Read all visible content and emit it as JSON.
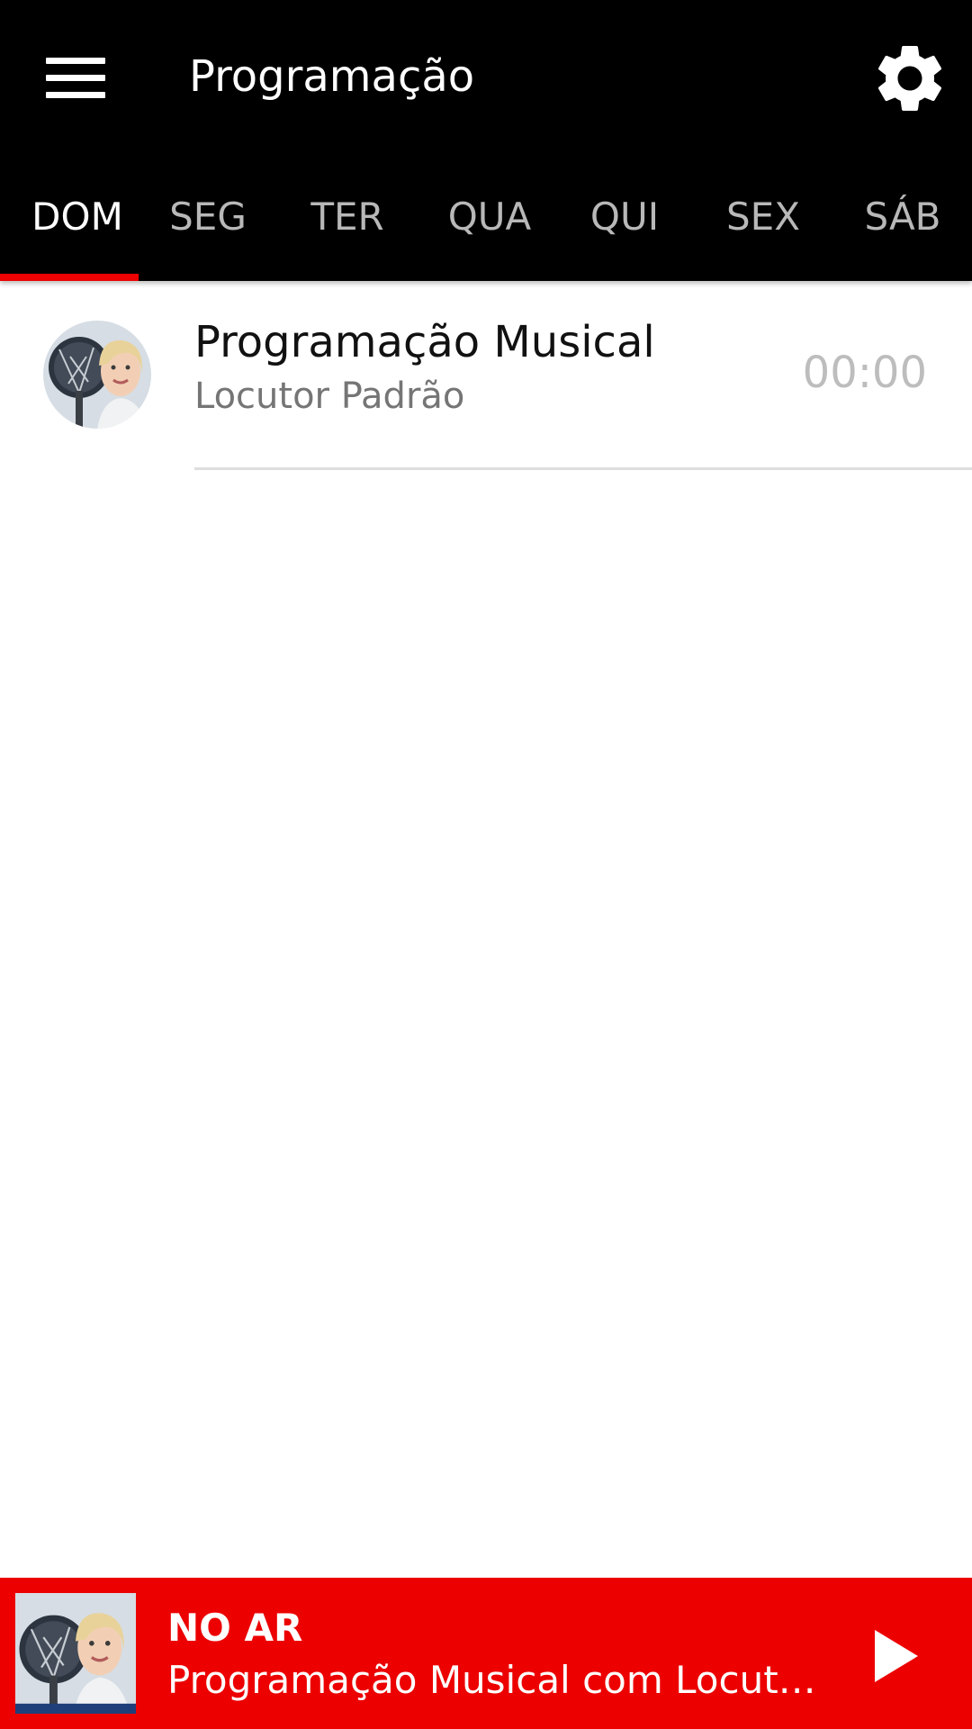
{
  "header": {
    "title": "Programação",
    "menu_icon": "hamburger-menu-icon",
    "settings_icon": "gear-icon"
  },
  "tabs": [
    {
      "label": "DOM",
      "active": true
    },
    {
      "label": "SEG",
      "active": false
    },
    {
      "label": "TER",
      "active": false
    },
    {
      "label": "QUA",
      "active": false
    },
    {
      "label": "QUI",
      "active": false
    },
    {
      "label": "SEX",
      "active": false
    },
    {
      "label": "SÁB",
      "active": false
    }
  ],
  "schedule": [
    {
      "title": "Programação Musical",
      "host": "Locutor Padrão",
      "time": "00:00",
      "avatar_icon": "host-avatar"
    }
  ],
  "player": {
    "label": "NO AR",
    "now_playing": "Programação Musical com Locutor Padrão",
    "play_icon": "play-icon"
  },
  "colors": {
    "appbar": "#000000",
    "accent": "#ec0000",
    "tab_active": "#ffffff",
    "tab_inactive": "#b8b8b8",
    "time_text": "#bdbdbd",
    "secondary_text": "#757575"
  }
}
